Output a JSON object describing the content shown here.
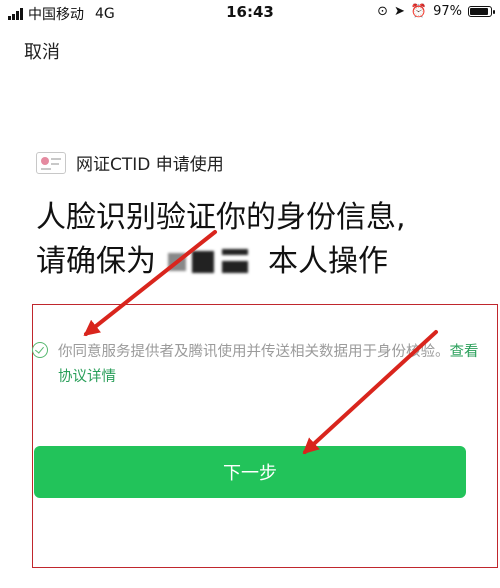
{
  "status_bar": {
    "carrier": "中国移动",
    "network": "4G",
    "time": "16:43",
    "battery": "97%",
    "battery_level": 0.97
  },
  "header": {
    "cancel_label": "取消"
  },
  "app": {
    "icon": "id-card-icon",
    "name": "网证CTID 申请使用"
  },
  "heading": {
    "line1": "人脸识别验证你的身份信息,",
    "line2_prefix": "请确保为",
    "line2_suffix": "本人操作"
  },
  "agreement": {
    "text": "你同意服务提供者及腾讯使用并传送相关数据用于身份核验。",
    "link": "查看协议详情"
  },
  "next_button": {
    "label": "下一步",
    "color": "#22c35a"
  },
  "annotation": {
    "color": "#d9251d"
  }
}
